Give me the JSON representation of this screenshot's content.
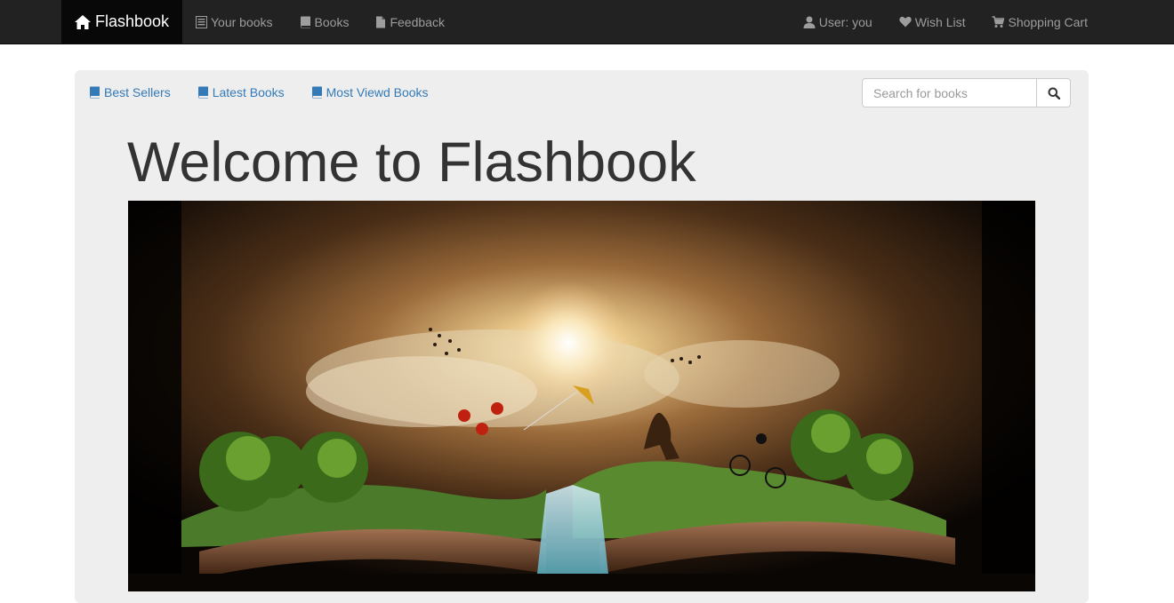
{
  "navbar": {
    "brand": "Flashbook",
    "left_items": [
      {
        "label": "Your books",
        "icon": "list-icon"
      },
      {
        "label": "Books",
        "icon": "book-icon"
      },
      {
        "label": "Feedback",
        "icon": "file-icon"
      }
    ],
    "right_items": [
      {
        "label": "User: you",
        "icon": "user-icon"
      },
      {
        "label": "Wish List",
        "icon": "heart-icon"
      },
      {
        "label": "Shopping Cart",
        "icon": "cart-icon"
      }
    ]
  },
  "subnav": [
    {
      "label": "Best Sellers",
      "icon": "book-icon"
    },
    {
      "label": "Latest Books",
      "icon": "book-icon"
    },
    {
      "label": "Most Viewd Books",
      "icon": "book-icon"
    }
  ],
  "search": {
    "placeholder": "Search for books",
    "button_icon": "search-icon"
  },
  "hero": {
    "title": "Welcome to Flashbook",
    "image": "open-book-fantasy-landscape"
  },
  "colors": {
    "navbar": "#222222",
    "brand_bg": "#080808",
    "link": "#337ab7",
    "panel": "#eeeeee",
    "nav_text": "#9d9d9d"
  }
}
